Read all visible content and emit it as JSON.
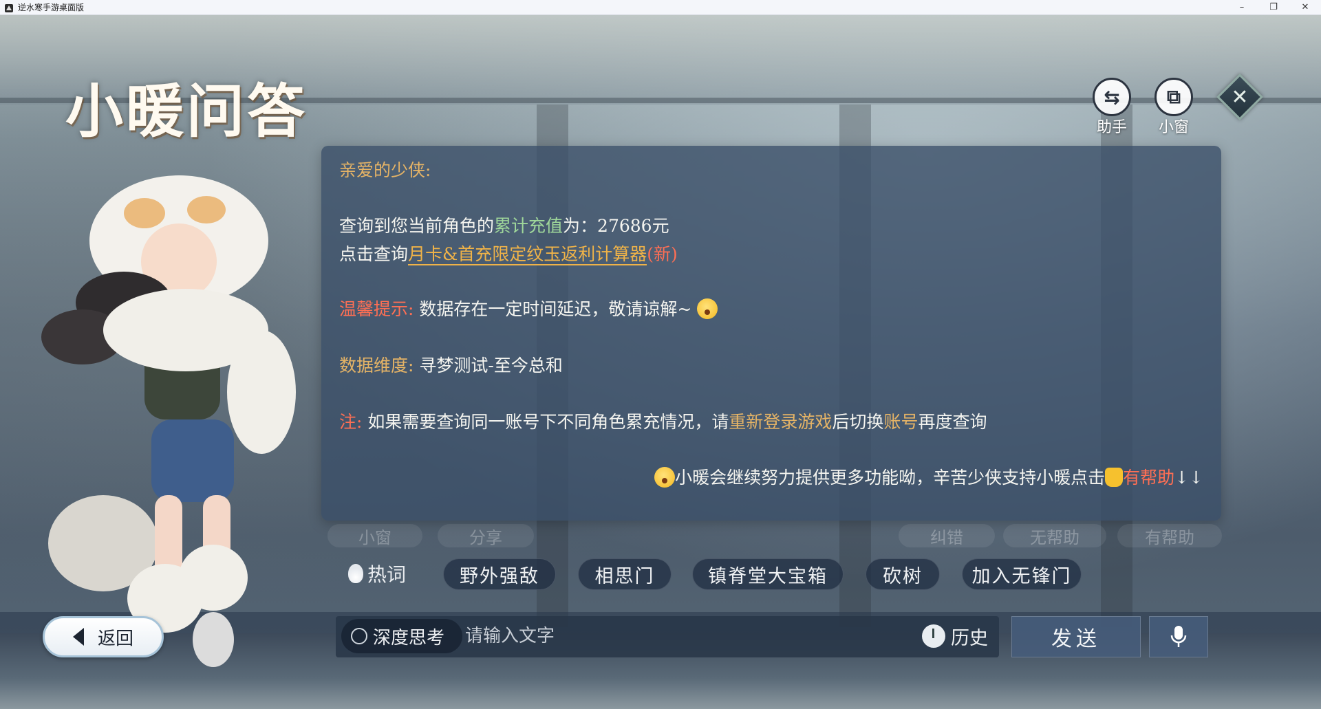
{
  "window": {
    "title": "逆水寒手游桌面版",
    "controls": {
      "minimize": "–",
      "maximize": "❐",
      "close": "✕"
    }
  },
  "header": {
    "logo_text": "小暖问答",
    "tools": [
      {
        "label": "助手",
        "icon": "swap-arrows-icon",
        "glyph": "⇆"
      },
      {
        "label": "小窗",
        "icon": "mini-window-icon",
        "glyph": "⧉"
      }
    ],
    "close_glyph": "✕"
  },
  "message": {
    "greeting": "亲爱的少侠:",
    "recharge_prefix": "查询到您当前角色的",
    "recharge_highlight": "累计充值",
    "recharge_mid": "为：",
    "recharge_value": "27686元",
    "calc_prefix": "点击查询",
    "calc_link": "月卡&首充限定纹玉返利计算器",
    "calc_new": "(新)",
    "tip_label": "温馨提示:",
    "tip_text": "数据存在一定时间延迟，敬请谅解~",
    "dimension_label": "数据维度:",
    "dimension_text": "寻梦测试-至今总和",
    "note_label": "注:",
    "note_text_1": "如果需要查询同一账号下不同角色累充情况，请",
    "note_highlight_1": "重新登录游戏",
    "note_text_2": "后切换",
    "note_highlight_2": "账号",
    "note_text_3": "再度查询",
    "footer_text": "小暖会继续努力提供更多功能呦，辛苦少侠支持小暖点击",
    "footer_helpful": "有帮助",
    "footer_arrows": "↓↓"
  },
  "feedback": {
    "mini_window": "小窗",
    "share": "分享",
    "report_error": "纠错",
    "not_helpful": "无帮助",
    "helpful": "有帮助"
  },
  "hot_words": {
    "label": "热词",
    "items": [
      "野外强敌",
      "相思门",
      "镇脊堂大宝箱",
      "砍树",
      "加入无锋门"
    ]
  },
  "input": {
    "back_label": "返回",
    "deep_think": "深度思考",
    "placeholder": "请输入文字",
    "history": "历史",
    "send": "发送"
  },
  "colors": {
    "panel_bg": "#3a4e68",
    "gold": "#e6b466",
    "green": "#9fd79a",
    "red": "#ff6f54",
    "link": "#f0b348"
  }
}
